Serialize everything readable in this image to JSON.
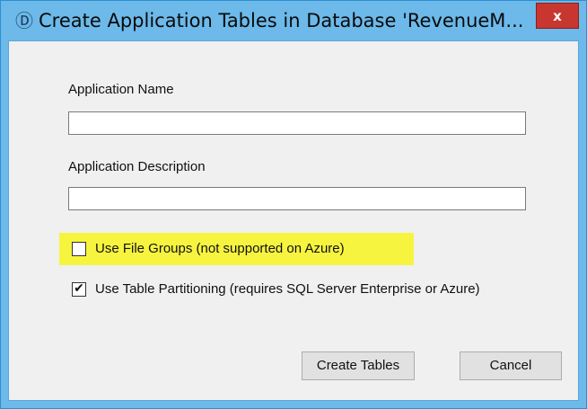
{
  "window": {
    "title": "Create Application Tables in Database 'RevenueM...",
    "close_label": "x",
    "icon": "app-dialog-icon"
  },
  "form": {
    "app_name": {
      "label": "Application Name",
      "value": "",
      "placeholder": ""
    },
    "app_description": {
      "label": "Application Description",
      "value": "",
      "placeholder": ""
    },
    "use_file_groups": {
      "label": "Use File Groups (not supported on Azure)",
      "checked": false
    },
    "use_table_partitioning": {
      "label": "Use Table Partitioning (requires SQL Server Enterprise or Azure)",
      "checked": true
    }
  },
  "buttons": {
    "create_tables": "Create Tables",
    "cancel": "Cancel"
  },
  "colors": {
    "titlebar": "#6cb9ea",
    "highlight": "#f7f43f",
    "close": "#c7372f"
  }
}
